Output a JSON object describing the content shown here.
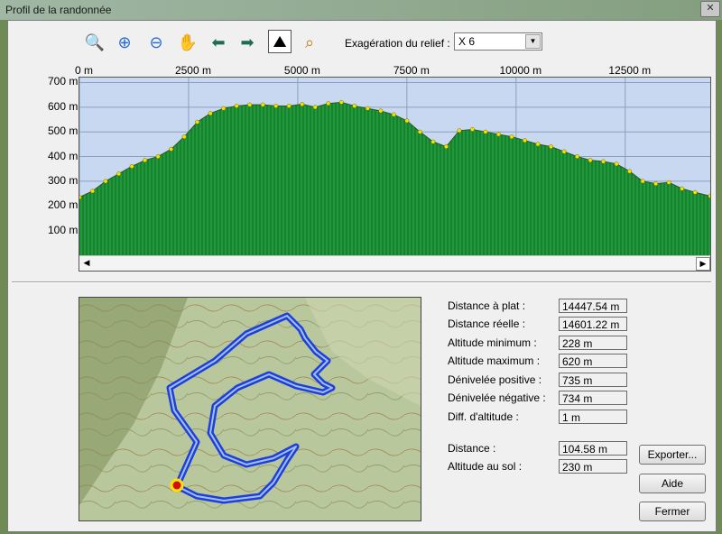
{
  "window": {
    "title": "Profil de la randonnée"
  },
  "toolbar": {
    "icons": [
      "zoom-view-icon",
      "zoom-in-icon",
      "zoom-out-icon",
      "pan-hand-icon",
      "arrow-left-icon",
      "arrow-right-icon",
      "terrain-icon",
      "zoom-track-icon"
    ],
    "exaggeration_label": "Exagération du relief :",
    "exaggeration_value": "X 6"
  },
  "chart_data": {
    "type": "area",
    "x_tick_labels": [
      "0 m",
      "2500 m",
      "5000 m",
      "7500 m",
      "10000 m",
      "12500 m"
    ],
    "y_tick_labels": [
      "700 m",
      "600 m",
      "500 m",
      "400 m",
      "300 m",
      "200 m",
      "100 m"
    ],
    "xlim": [
      0,
      14447.54
    ],
    "ylim": [
      0,
      720
    ],
    "x": [
      0,
      300,
      600,
      900,
      1200,
      1500,
      1800,
      2100,
      2400,
      2700,
      3000,
      3300,
      3600,
      3900,
      4200,
      4500,
      4800,
      5100,
      5400,
      5700,
      6000,
      6300,
      6600,
      6900,
      7200,
      7500,
      7800,
      8100,
      8400,
      8700,
      9000,
      9300,
      9600,
      9900,
      10200,
      10500,
      10800,
      11100,
      11400,
      11700,
      12000,
      12300,
      12600,
      12900,
      13200,
      13500,
      13800,
      14100,
      14447
    ],
    "y": [
      235,
      260,
      300,
      330,
      360,
      385,
      400,
      430,
      480,
      540,
      575,
      595,
      605,
      610,
      610,
      605,
      605,
      612,
      600,
      615,
      620,
      605,
      595,
      585,
      570,
      545,
      500,
      460,
      440,
      505,
      510,
      500,
      490,
      480,
      465,
      450,
      440,
      420,
      400,
      385,
      380,
      370,
      340,
      300,
      290,
      295,
      270,
      255,
      240
    ],
    "colors": {
      "sky": "#c8d8f0",
      "fill": "#1f9a3a",
      "dots": "#f4e200",
      "grid": "#8aa0c0"
    }
  },
  "info": {
    "labels": [
      "Distance à plat :",
      "Distance réelle :",
      "Altitude minimum :",
      "Altitude maximum :",
      "Dénivelée positive :",
      "Dénivelée négative :",
      "Diff. d'altitude :"
    ],
    "values": [
      "14447.54 m",
      "14601.22 m",
      "228 m",
      "620 m",
      "735 m",
      "734 m",
      "1 m"
    ],
    "cursor_labels": [
      "Distance :",
      "Altitude au sol :"
    ],
    "cursor_values": [
      "104.58 m",
      "230 m"
    ]
  },
  "buttons": {
    "export": "Exporter...",
    "help": "Aide",
    "close": "Fermer"
  }
}
